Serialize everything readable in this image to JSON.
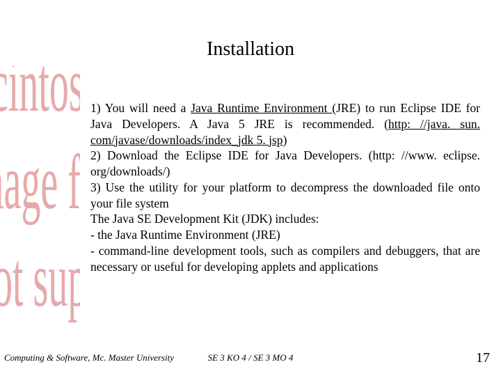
{
  "title": "Installation",
  "bg": {
    "w1": "acintosh P",
    "w2": "mage form",
    "w3": "not suppo"
  },
  "body": {
    "p1_a": "1) You will need a ",
    "p1_link1": "Java Runtime Environment ",
    "p1_b": "(JRE) to run Eclipse IDE for Java Developers. A Java 5 JRE is recommended. ",
    "p1_paren_open": "(",
    "p1_link2": "http: //java. sun. com/javase/downloads/index_jdk 5. jsp",
    "p1_paren_close": ")",
    "p2": "2)   Download    the    Eclipse    IDE    for    Java    Developers. (http: //www. eclipse. org/downloads/)",
    "p3": "3)    Use the utility for your platform to decompress the downloaded file onto your file system",
    "p4": "The Java SE Development Kit (JDK) includes:",
    "p5": "- the Java Runtime Environment (JRE)",
    "p6": "- command-line development tools, such as compilers and debuggers, that are necessary or useful for developing applets and applications"
  },
  "footer": {
    "left": "Computing & Software, Mc. Master University",
    "center": "SE 3 KO 4 / SE 3 MO 4",
    "right": "17"
  }
}
